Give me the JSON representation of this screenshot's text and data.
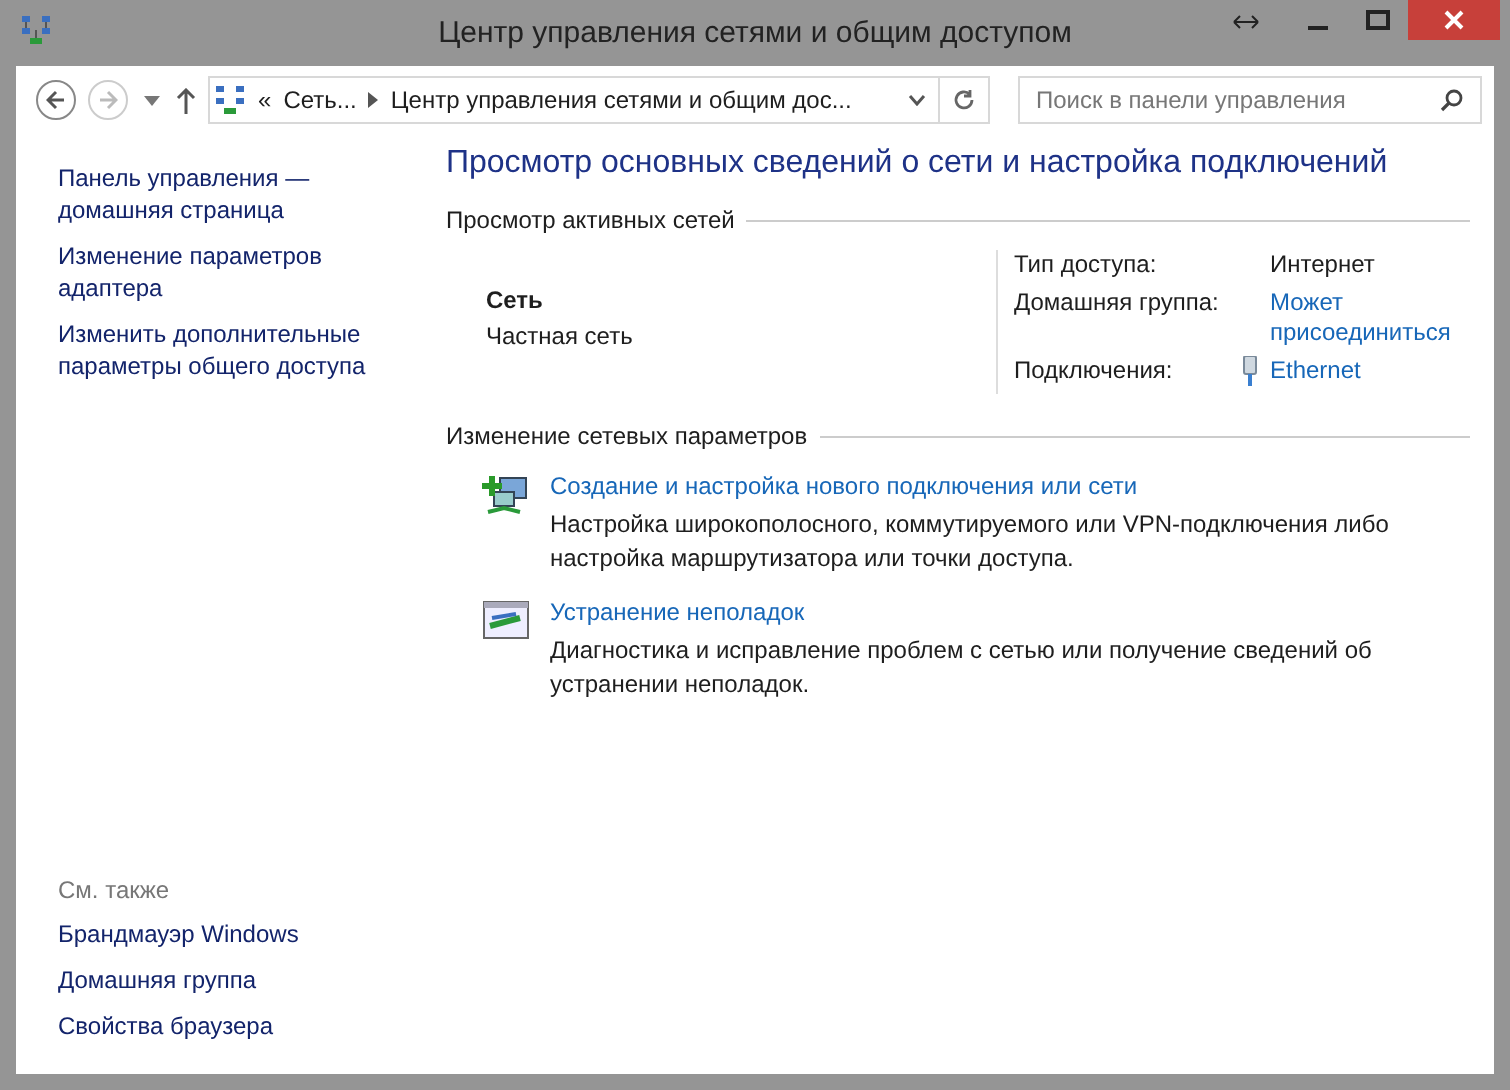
{
  "window": {
    "title": "Центр управления сетями и общим доступом"
  },
  "address_bar": {
    "overflow": "«",
    "crumbs": [
      "Сеть...",
      "Центр управления сетями и общим дос..."
    ]
  },
  "search": {
    "placeholder": "Поиск в панели управления"
  },
  "sidebar": {
    "links": [
      "Панель управления — домашняя страница",
      "Изменение параметров адаптера",
      "Изменить дополнительные параметры общего доступа"
    ],
    "see_also": {
      "heading": "См. также",
      "links": [
        "Брандмауэр Windows",
        "Домашняя группа",
        "Свойства браузера"
      ]
    }
  },
  "main": {
    "heading": "Просмотр основных сведений о сети и настройка подключений",
    "active_networks": {
      "title": "Просмотр активных сетей",
      "network_name": "Сеть",
      "network_type": "Частная сеть",
      "properties": [
        {
          "label": "Тип доступа:",
          "value": "Интернет",
          "kind": "text"
        },
        {
          "label": "Домашняя группа:",
          "value": "Может присоединиться",
          "kind": "link"
        },
        {
          "label": "Подключения:",
          "value": "Ethernet",
          "kind": "connection"
        }
      ]
    },
    "change_settings": {
      "title": "Изменение сетевых параметров",
      "tasks": [
        {
          "kind": "new-connection",
          "title": "Создание и настройка нового подключения или сети",
          "description": "Настройка широкополосного, коммутируемого или VPN-подключения либо настройка маршрутизатора или точки доступа."
        },
        {
          "kind": "troubleshoot",
          "title": "Устранение неполадок",
          "description": "Диагностика и исправление проблем с сетью или получение сведений об устранении неполадок."
        }
      ]
    }
  }
}
